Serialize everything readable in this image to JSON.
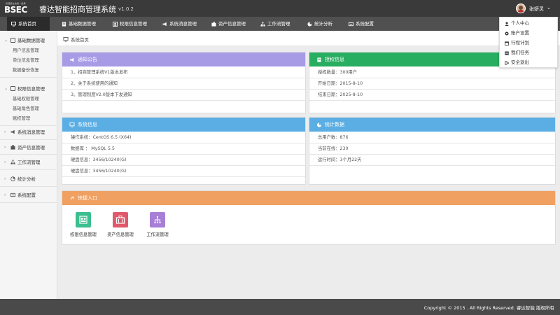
{
  "header": {
    "logo_slogan": "智慧事业的第一选择",
    "logo_mark": "BSEC",
    "title": "睿达智能招商管理系统",
    "version": "v1.0.2",
    "username": "张妍灵",
    "caret": "⌄"
  },
  "topnav": {
    "items": [
      {
        "label": "系统首页",
        "icon": "monitor-icon"
      },
      {
        "label": "基础数据管理",
        "icon": "document-icon"
      },
      {
        "label": "权限信息管理",
        "icon": "users-icon"
      },
      {
        "label": "系统消息管理",
        "icon": "megaphone-icon"
      },
      {
        "label": "资产信息管理",
        "icon": "briefcase-icon"
      },
      {
        "label": "工作流管理",
        "icon": "sitemap-icon"
      },
      {
        "label": "统计分析",
        "icon": "pie-chart-icon"
      },
      {
        "label": "系统配置",
        "icon": "settings-icon"
      }
    ]
  },
  "user_menu": {
    "items": [
      {
        "label": "个人中心",
        "icon": "user-icon"
      },
      {
        "label": "账户设置",
        "icon": "gear-icon"
      },
      {
        "label": "行程计划",
        "icon": "calendar-icon"
      },
      {
        "label": "我们任务",
        "icon": "tasks-icon"
      },
      {
        "label": "安全退出",
        "icon": "logout-icon"
      }
    ]
  },
  "sidebar": {
    "groups": [
      {
        "label": "基础数据管理",
        "caret": "⌄",
        "children": [
          "用户信息管理",
          "单位信息管理",
          "数据备份恢复"
        ]
      },
      {
        "label": "权限信息管理",
        "caret": "⌄",
        "children": [
          "基础权限管理",
          "基础角色管理",
          "赋权管理"
        ]
      },
      {
        "label": "系统消息管理",
        "caret": "›"
      },
      {
        "label": "资产信息管理",
        "caret": "›"
      },
      {
        "label": "工作流管理",
        "caret": "›"
      },
      {
        "label": "统计分析",
        "caret": "›"
      },
      {
        "label": "系统配置",
        "caret": "›"
      }
    ]
  },
  "breadcrumb": {
    "label": "系统首页"
  },
  "panels": {
    "notice": {
      "title": "通知公告",
      "rows": [
        "1、招商管理系统V1版本发布",
        "2、关于系统使用的通知",
        "3、管理制度V2.0版本下发通知"
      ]
    },
    "license": {
      "title": "授权信息",
      "rows": [
        "授权数量：300用户",
        "开始日期：2015-8-10",
        "结束日期：2025-8-10"
      ]
    },
    "sysinfo": {
      "title": "系统信息",
      "rows": [
        "操作系统：CentOS 6.5 (X64)",
        "数据库 ： MySQL 5.5",
        "硬盘信息：3456/10240(G)",
        "硬盘信息：3456/10240(G)"
      ]
    },
    "stats": {
      "title": "统计数据",
      "rows": [
        "总用户数：876",
        "当前在线：230",
        "运行时间：3个月22天"
      ]
    },
    "quick": {
      "title": "快捷入口",
      "items": [
        {
          "label": "权限信息管理",
          "icon": "users-icon",
          "color": "#3cbf8f"
        },
        {
          "label": "资产信息管理",
          "icon": "briefcase-icon",
          "color": "#e0596b"
        },
        {
          "label": "工作流管理",
          "icon": "sitemap-icon",
          "color": "#a77fd6"
        }
      ]
    }
  },
  "colors": {
    "notice": "#a89be6",
    "license": "#27ae60",
    "sysinfo": "#5aaee4",
    "stats": "#5aaee4",
    "quick": "#f0a060"
  },
  "footer": {
    "copyright": "Copyright © 2015 . All Rights Reserved. 睿达智能 版权所有"
  }
}
